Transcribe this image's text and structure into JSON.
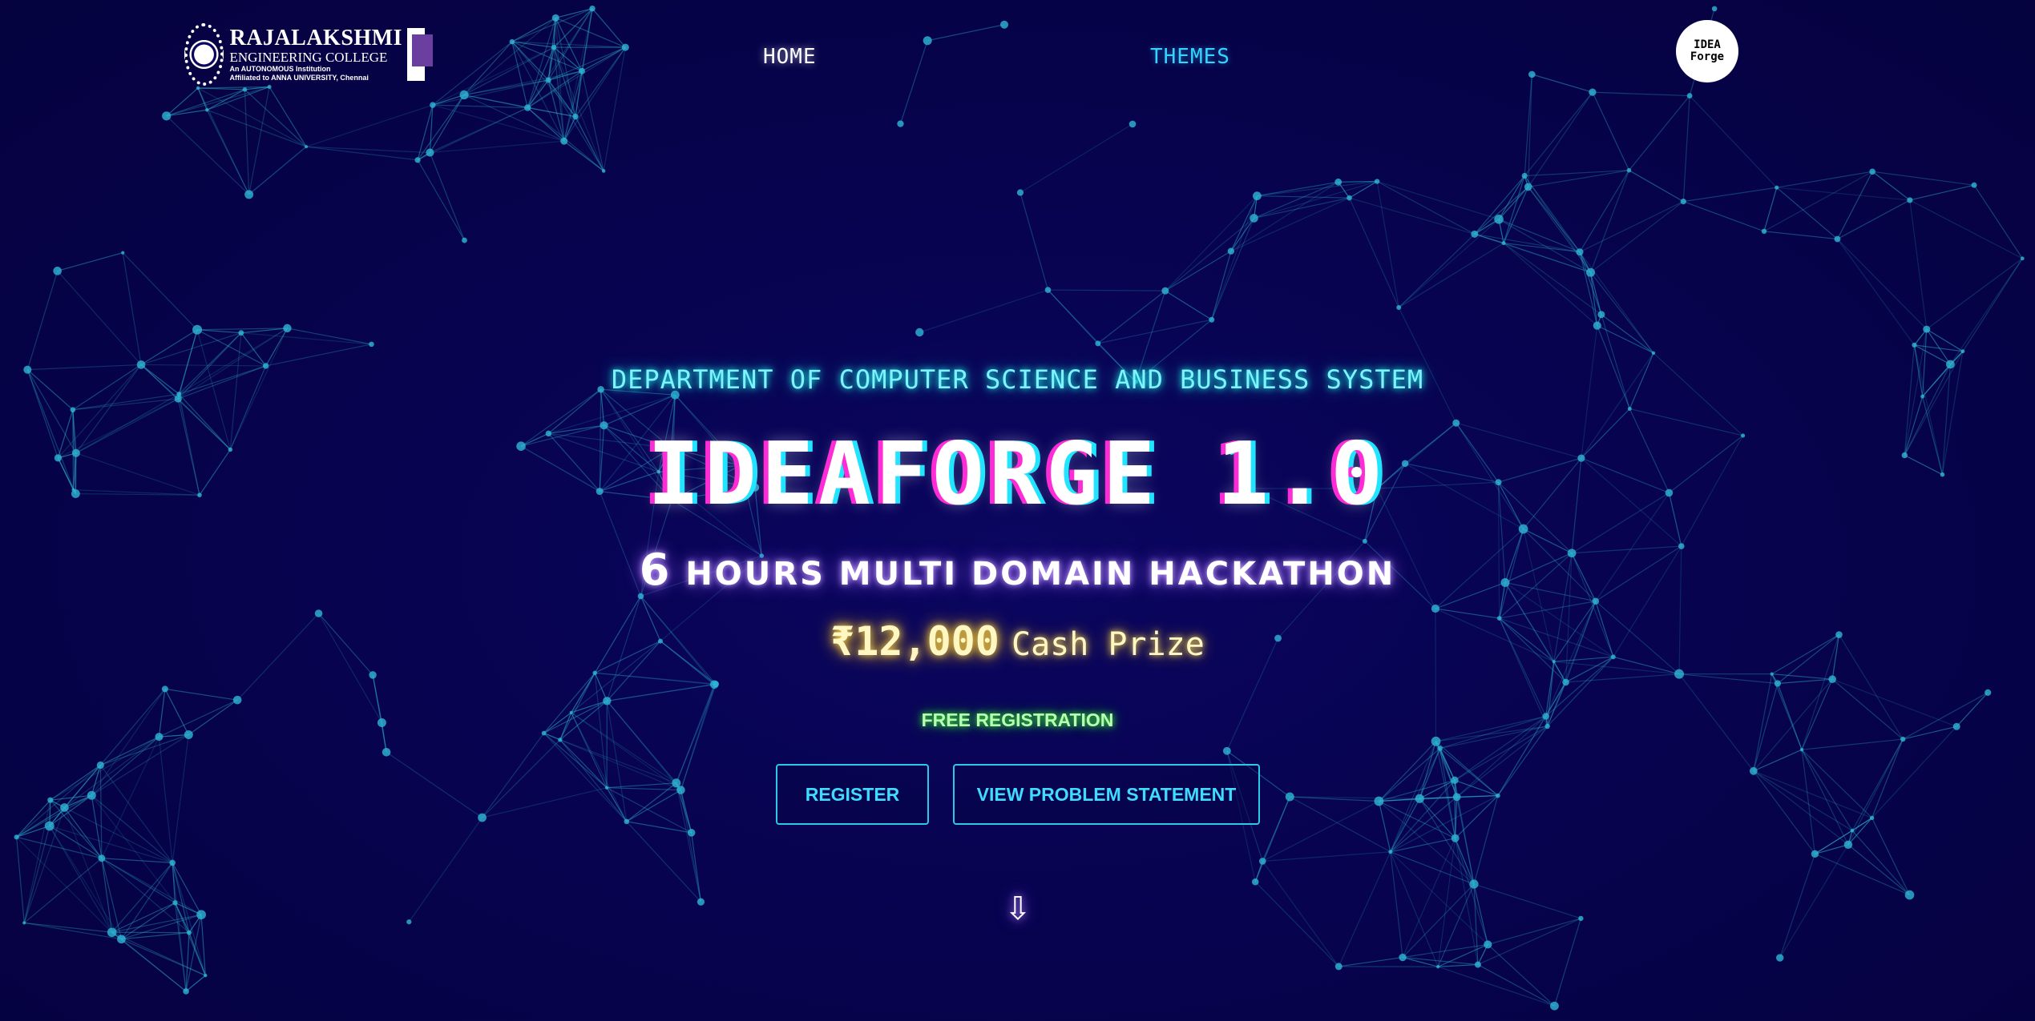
{
  "header": {
    "college_logo": {
      "name_line1": "RAJALAKSHMI",
      "name_line2": "ENGINEERING COLLEGE",
      "line3": "An AUTONOMOUS Institution",
      "line4": "Affiliated to ANNA UNIVERSITY, Chennai"
    },
    "nav": {
      "home": "HOME",
      "themes": "THEMES"
    },
    "ideaforge_logo": {
      "line1": "IDEA",
      "line2": "Forge"
    }
  },
  "hero": {
    "department": "DEPARTMENT OF COMPUTER SCIENCE AND BUSINESS SYSTEM",
    "title": "IDEAFORGE 1.0",
    "subtitle_number": "6",
    "subtitle_text": "HOURS MULTI DOMAIN HACKATHON",
    "prize_amount": "₹12,000",
    "prize_label": "Cash Prize",
    "free_registration": "FREE REGISTRATION",
    "register_button": "REGISTER",
    "problem_button": "VIEW PROBLEM STATEMENT",
    "scroll_arrow": "⇩"
  },
  "colors": {
    "background": "#06024a",
    "accent_cyan": "#34d4ff",
    "network_line": "#2aa6c8",
    "prize_glow": "#ffd84a",
    "free_glow": "#38e838"
  }
}
